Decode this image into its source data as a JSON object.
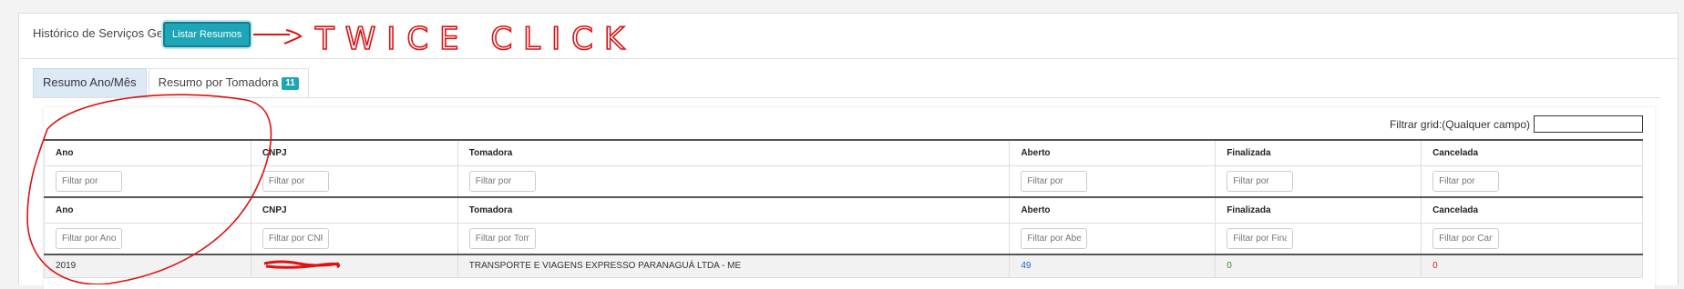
{
  "panel": {
    "title": "Histórico de Serviços Geral",
    "list_button": "Listar Resumos"
  },
  "annotation": {
    "text": "TWICE CLICK"
  },
  "tabs": [
    {
      "label": "Resumo Ano/Mês",
      "active": true
    },
    {
      "label": "Resumo por Tomadora",
      "badge": "11",
      "active": false
    }
  ],
  "grid_filter": {
    "label": "Filtrar grid:(Qualquer campo)",
    "value": ""
  },
  "columns": [
    "Ano",
    "CNPJ",
    "Tomadora",
    "Aberto",
    "Finalizada",
    "Cancelada"
  ],
  "filter_placeholder": "Filtar por",
  "filter_placeholders_2": [
    "Filtar por Ano",
    "Filtar por CNPJ",
    "Filtar por Tomadora",
    "Filtar por Aberto",
    "Filtar por Finalizada",
    "Filtar por Cancelada"
  ],
  "rows": [
    {
      "ano": "2019",
      "cnpj": "[redacted]",
      "tomadora": "TRANSPORTE E VIAGENS EXPRESSO PARANAGUÁ LTDA - ME",
      "aberto": "49",
      "finalizada": "0",
      "cancelada": "0"
    }
  ],
  "colors": {
    "accent": "#1ea6b8",
    "aberto": "#1a66c9",
    "finalizada": "#2e8b2e",
    "cancelada": "#d02525",
    "annotation": "#e01010"
  }
}
